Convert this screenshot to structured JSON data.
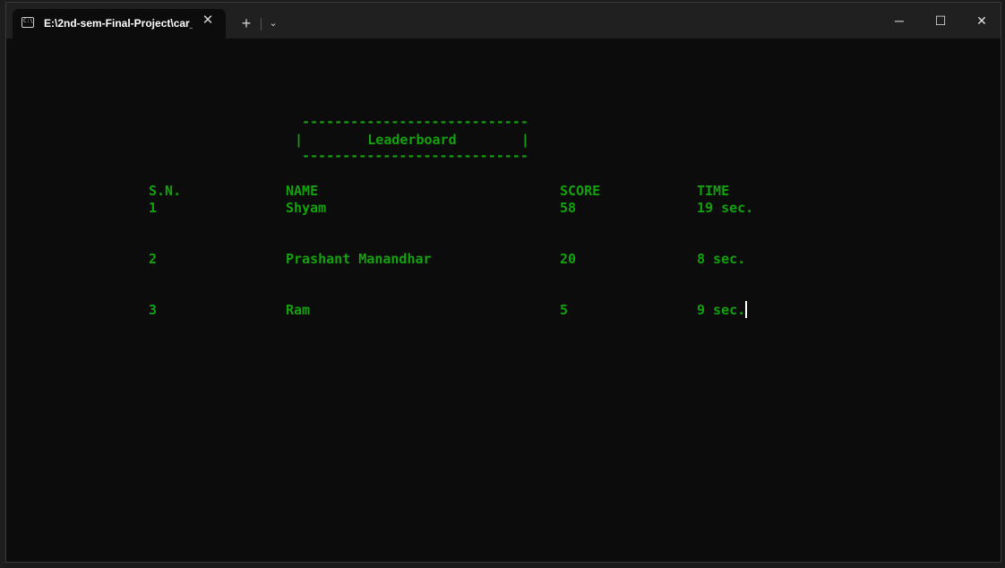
{
  "window": {
    "tab_title": "E:\\2nd-sem-Final-Project\\car_",
    "tab_icon": "terminal-icon",
    "close_tab_glyph": "✕",
    "new_tab_glyph": "+",
    "dropdown_glyph": "⌄",
    "minimize_glyph": "─",
    "maximize_glyph": "☐",
    "close_glyph": "✕"
  },
  "terminal": {
    "text_color": "#13a10e",
    "background": "#0c0c0c",
    "banner": {
      "top_rule": "----------------------------",
      "title_line": "|        Leaderboard        |",
      "bottom_rule": "----------------------------"
    },
    "headers": {
      "sn": "S.N.",
      "name": "NAME",
      "score": "SCORE",
      "time": "TIME"
    },
    "rows": [
      {
        "sn": "1",
        "name": "Shyam",
        "score": "58",
        "time": "19 sec."
      },
      {
        "sn": "2",
        "name": "Prashant Manandhar",
        "score": "20",
        "time": "8 sec."
      },
      {
        "sn": "3",
        "name": "Ram",
        "score": "5",
        "time": "9 sec."
      }
    ]
  }
}
